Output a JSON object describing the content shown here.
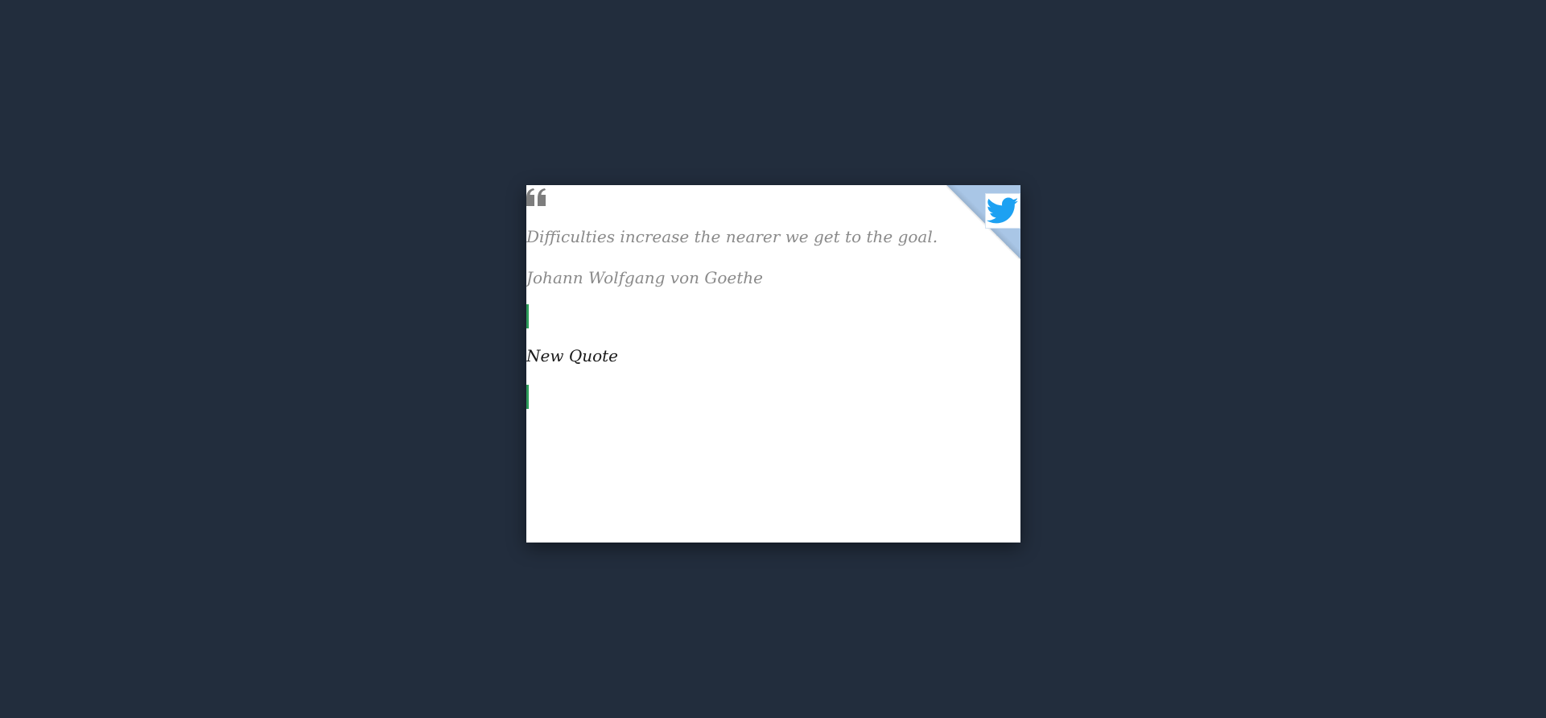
{
  "quote": {
    "text": "Difficulties increase the nearer we get to the goal.",
    "author": "Johann Wolfgang von Goethe"
  },
  "actions": {
    "new_quote_label": "New Quote",
    "tweet_icon": "twitter-bird-icon"
  },
  "icons": {
    "quote_mark": "quote-left-icon"
  },
  "colors": {
    "background": "#222d3d",
    "card": "#ffffff",
    "quote_text": "#8a8a8a",
    "button_text": "#1a1a1a",
    "accent_bar": "#2e9d5b",
    "twitter_blue": "#1da1f2",
    "fold": "#a9c6e6"
  }
}
